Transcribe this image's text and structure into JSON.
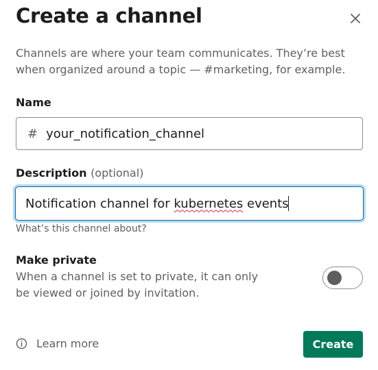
{
  "dialog": {
    "title": "Create a channel",
    "intro": "Channels are where your team communicates. They’re best when organized around a topic — #marketing, for example."
  },
  "name_field": {
    "label": "Name",
    "prefix": "#",
    "value": "your_notification_channel"
  },
  "description_field": {
    "label": "Description",
    "optional_label": "(optional)",
    "value_before": "Notification channel for ",
    "value_misspelled": "kubernetes",
    "value_after": " events",
    "hint": "What’s this channel about?"
  },
  "private": {
    "label": "Make private",
    "description": "When a channel is set to private, it can only be viewed or joined by invitation.",
    "enabled": false
  },
  "footer": {
    "learn_more": "Learn more",
    "create_label": "Create"
  },
  "colors": {
    "primary_button": "#007a5a",
    "focus_border": "#1264a3",
    "spellcheck": "#e01e5a"
  },
  "icons": {
    "close": "close-icon",
    "info": "info-icon"
  }
}
